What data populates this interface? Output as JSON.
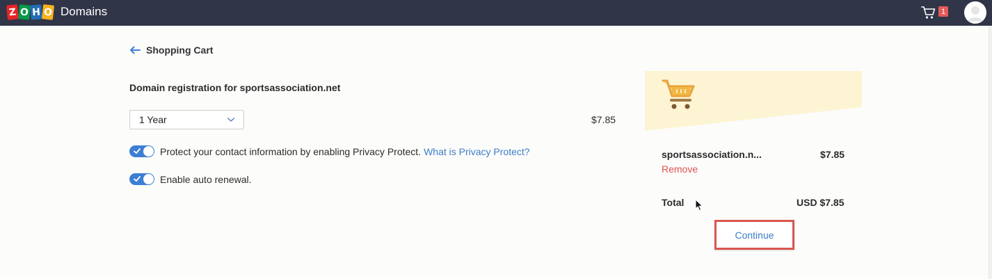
{
  "header": {
    "logo_letters": [
      "Z",
      "O",
      "H",
      "O"
    ],
    "app_name": "Domains",
    "cart_icon": "shopping-cart-icon",
    "cart_count": "1",
    "avatar_icon": "user-avatar"
  },
  "nav": {
    "back_icon": "arrow-left-icon",
    "back_label": "Shopping Cart"
  },
  "registration": {
    "title": "Domain registration for sportsassociation.net",
    "period_value": "1 Year",
    "price": "$7.85",
    "privacy_toggle_on": true,
    "privacy_text": "Protect your contact information by enabling Privacy Protect.",
    "privacy_link": "What is Privacy Protect?",
    "renewal_toggle_on": true,
    "renewal_text": "Enable auto renewal."
  },
  "summary": {
    "banner_icon": "shopping-cart-icon",
    "item_name": "sportsassociation.n...",
    "item_price": "$7.85",
    "remove_label": "Remove",
    "total_label": "Total",
    "total_value": "USD $7.85",
    "continue_label": "Continue"
  },
  "colors": {
    "topbar": "#313548",
    "accent_blue": "#3c7fd4",
    "link_blue": "#3b7dc7",
    "remove_red": "#e0524c",
    "banner_yellow": "#fdf4d3",
    "cart_orange": "#e9a23b",
    "highlight_red": "#d9574f"
  }
}
